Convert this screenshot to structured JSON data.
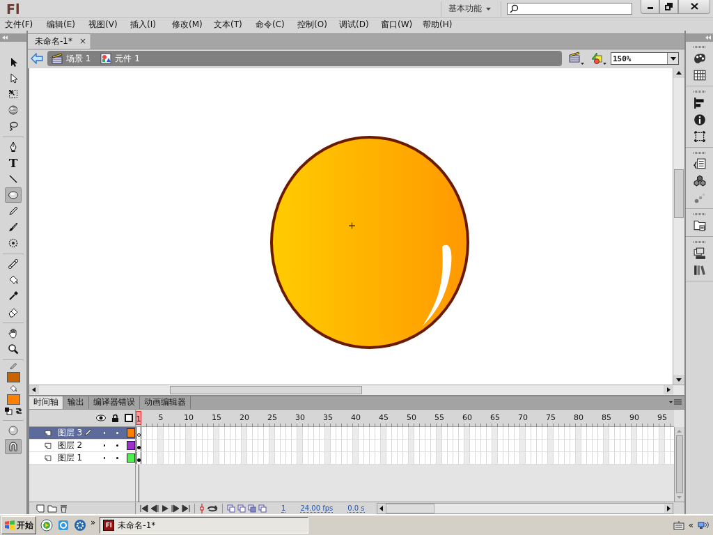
{
  "title_bar": {
    "logo": "Fl",
    "workspace": "基本功能"
  },
  "menu": [
    "文件(F)",
    "编辑(E)",
    "视图(V)",
    "插入(I)",
    "修改(M)",
    "文本(T)",
    "命令(C)",
    "控制(O)",
    "调试(D)",
    "窗口(W)",
    "帮助(H)"
  ],
  "document_tabs": [
    {
      "title": "未命名-1*",
      "close": "×",
      "selected": true
    }
  ],
  "breadcrumb": [
    {
      "kind": "scene",
      "label": "场景 1"
    },
    {
      "kind": "symbol",
      "label": "元件 1"
    }
  ],
  "zoom": "150%",
  "tools": [
    {
      "kind": "arrow",
      "selected": false
    },
    {
      "kind": "subselect",
      "selected": false
    },
    {
      "kind": "transform",
      "selected": false
    },
    {
      "kind": "sphere",
      "selected": false
    },
    {
      "kind": "lasso",
      "selected": false
    },
    {
      "kind": "separator"
    },
    {
      "kind": "pen",
      "selected": false
    },
    {
      "kind": "text",
      "label": "T",
      "selected": false
    },
    {
      "kind": "line",
      "selected": false
    },
    {
      "kind": "oval",
      "selected": true
    },
    {
      "kind": "pencil",
      "selected": false
    },
    {
      "kind": "brush",
      "selected": false
    },
    {
      "kind": "deco",
      "selected": false
    },
    {
      "kind": "separator"
    },
    {
      "kind": "bone",
      "selected": false
    },
    {
      "kind": "bucket",
      "selected": false
    },
    {
      "kind": "dropper",
      "selected": false
    },
    {
      "kind": "eraser",
      "selected": false
    },
    {
      "kind": "separator"
    },
    {
      "kind": "hand",
      "selected": false
    },
    {
      "kind": "zoom",
      "selected": false
    }
  ],
  "swatches": [
    {
      "kind": "stroke",
      "color": "#c86400"
    },
    {
      "kind": "fill",
      "color": "#ff8000"
    }
  ],
  "options": [
    {
      "kind": "object-drawing",
      "on": false
    },
    {
      "kind": "snap",
      "on": true
    }
  ],
  "timeline": {
    "tabs": [
      {
        "label": "时间轴",
        "selected": true
      },
      {
        "label": "输出",
        "selected": false
      },
      {
        "label": "编译器错误",
        "selected": false
      },
      {
        "label": "动画编辑器",
        "selected": false
      }
    ],
    "ruler": [
      {
        "label": "1",
        "playhead": true
      },
      {
        "label": "5",
        "playhead": false
      },
      {
        "label": "10",
        "playhead": false
      },
      {
        "label": "15",
        "playhead": false
      },
      {
        "label": "20",
        "playhead": false
      },
      {
        "label": "25",
        "playhead": false
      },
      {
        "label": "30",
        "playhead": false
      },
      {
        "label": "35",
        "playhead": false
      },
      {
        "label": "40",
        "playhead": false
      },
      {
        "label": "45",
        "playhead": false
      },
      {
        "label": "50",
        "playhead": false
      },
      {
        "label": "55",
        "playhead": false
      },
      {
        "label": "60",
        "playhead": false
      },
      {
        "label": "65",
        "playhead": false
      },
      {
        "label": "70",
        "playhead": false
      },
      {
        "label": "75",
        "playhead": false
      },
      {
        "label": "80",
        "playhead": false
      },
      {
        "label": "85",
        "playhead": false
      },
      {
        "label": "90",
        "playhead": false
      },
      {
        "label": "95",
        "playhead": false
      }
    ],
    "layers": [
      {
        "name": "图层 3",
        "selected": true,
        "editing": true,
        "color": "#ff8000",
        "empty_keyframe": true
      },
      {
        "name": "图层 2",
        "selected": false,
        "editing": false,
        "color": "#9933cc",
        "empty_keyframe": false
      },
      {
        "name": "图层 1",
        "selected": false,
        "editing": false,
        "color": "#4cf04c",
        "empty_keyframe": false
      }
    ],
    "current_frame": "1",
    "frame_rate": "24.00 fps",
    "elapsed": "0.0 s"
  },
  "taskbar": {
    "start": "开始",
    "more": "»",
    "task": {
      "icon": "Fl",
      "title": "未命名-1*"
    },
    "tray_toggle": "«"
  }
}
